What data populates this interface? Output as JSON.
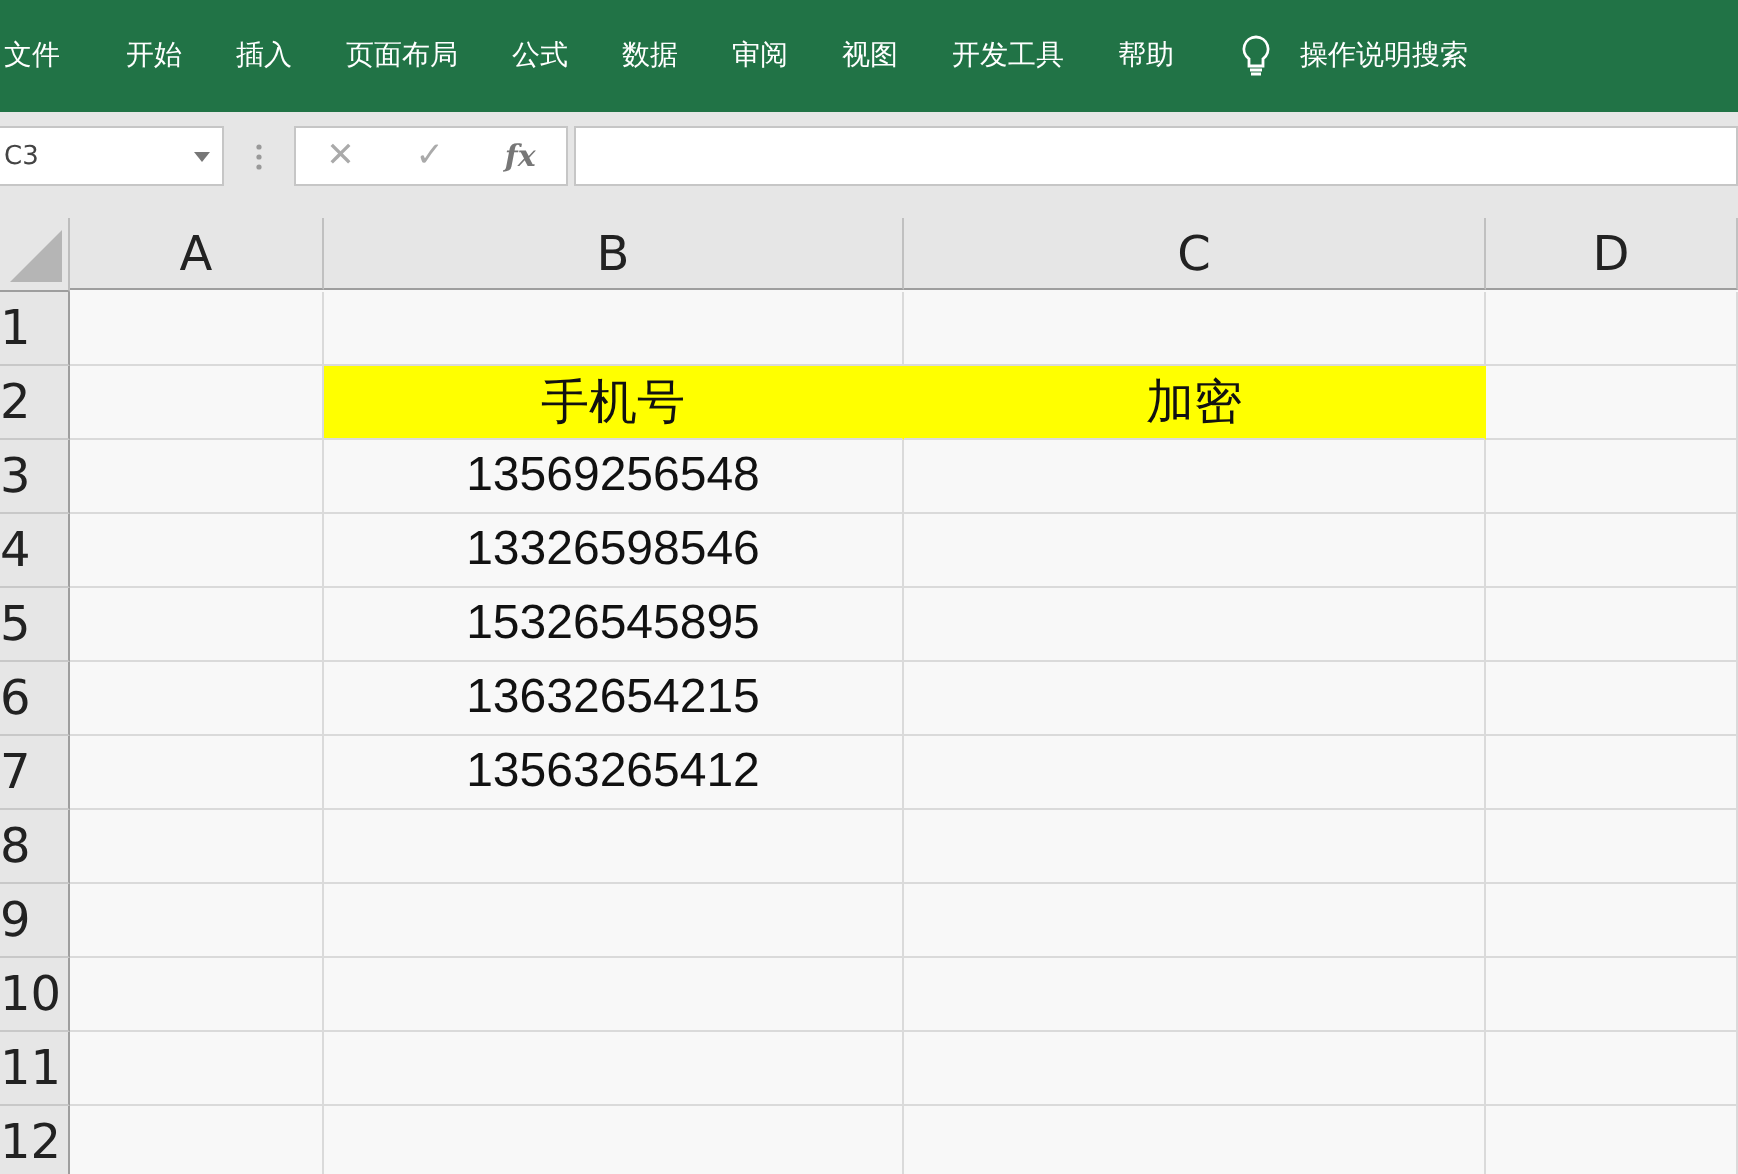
{
  "ribbon": {
    "tabs": [
      "文件",
      "开始",
      "插入",
      "页面布局",
      "公式",
      "数据",
      "审阅",
      "视图",
      "开发工具",
      "帮助"
    ],
    "search": "操作说明搜索"
  },
  "formula_bar": {
    "name_box": "C3",
    "cancel": "✕",
    "enter": "✓",
    "fx": "fx"
  },
  "sheet": {
    "columns": [
      "A",
      "B",
      "C",
      "D"
    ],
    "rows": [
      {
        "header": "1",
        "cells": [
          {
            "highlighted": false
          },
          {
            "highlighted": false
          },
          {
            "highlighted": false
          },
          {
            "highlighted": false
          }
        ]
      },
      {
        "header": "2",
        "cells": [
          {
            "highlighted": false
          },
          {
            "text": "手机号",
            "highlighted": true
          },
          {
            "text": "加密",
            "highlighted": true
          },
          {
            "highlighted": false
          }
        ]
      },
      {
        "header": "3",
        "cells": [
          {
            "highlighted": false
          },
          {
            "text": "13569256548",
            "highlighted": false
          },
          {
            "highlighted": false
          },
          {
            "highlighted": false
          }
        ]
      },
      {
        "header": "4",
        "cells": [
          {
            "highlighted": false
          },
          {
            "text": "13326598546",
            "highlighted": false
          },
          {
            "highlighted": false
          },
          {
            "highlighted": false
          }
        ]
      },
      {
        "header": "5",
        "cells": [
          {
            "highlighted": false
          },
          {
            "text": "15326545895",
            "highlighted": false
          },
          {
            "highlighted": false
          },
          {
            "highlighted": false
          }
        ]
      },
      {
        "header": "6",
        "cells": [
          {
            "highlighted": false
          },
          {
            "text": "13632654215",
            "highlighted": false
          },
          {
            "highlighted": false
          },
          {
            "highlighted": false
          }
        ]
      },
      {
        "header": "7",
        "cells": [
          {
            "highlighted": false
          },
          {
            "text": "13563265412",
            "highlighted": false
          },
          {
            "highlighted": false
          },
          {
            "highlighted": false
          }
        ]
      },
      {
        "header": "8",
        "cells": [
          {
            "highlighted": false
          },
          {
            "highlighted": false
          },
          {
            "highlighted": false
          },
          {
            "highlighted": false
          }
        ]
      },
      {
        "header": "9",
        "cells": [
          {
            "highlighted": false
          },
          {
            "highlighted": false
          },
          {
            "highlighted": false
          },
          {
            "highlighted": false
          }
        ]
      },
      {
        "header": "10",
        "cells": [
          {
            "highlighted": false
          },
          {
            "highlighted": false
          },
          {
            "highlighted": false
          },
          {
            "highlighted": false
          }
        ]
      },
      {
        "header": "11",
        "cells": [
          {
            "highlighted": false
          },
          {
            "highlighted": false
          },
          {
            "highlighted": false
          },
          {
            "highlighted": false
          }
        ]
      },
      {
        "header": "12",
        "cells": [
          {
            "highlighted": false
          },
          {
            "highlighted": false
          },
          {
            "highlighted": false
          },
          {
            "highlighted": false
          }
        ]
      }
    ]
  }
}
